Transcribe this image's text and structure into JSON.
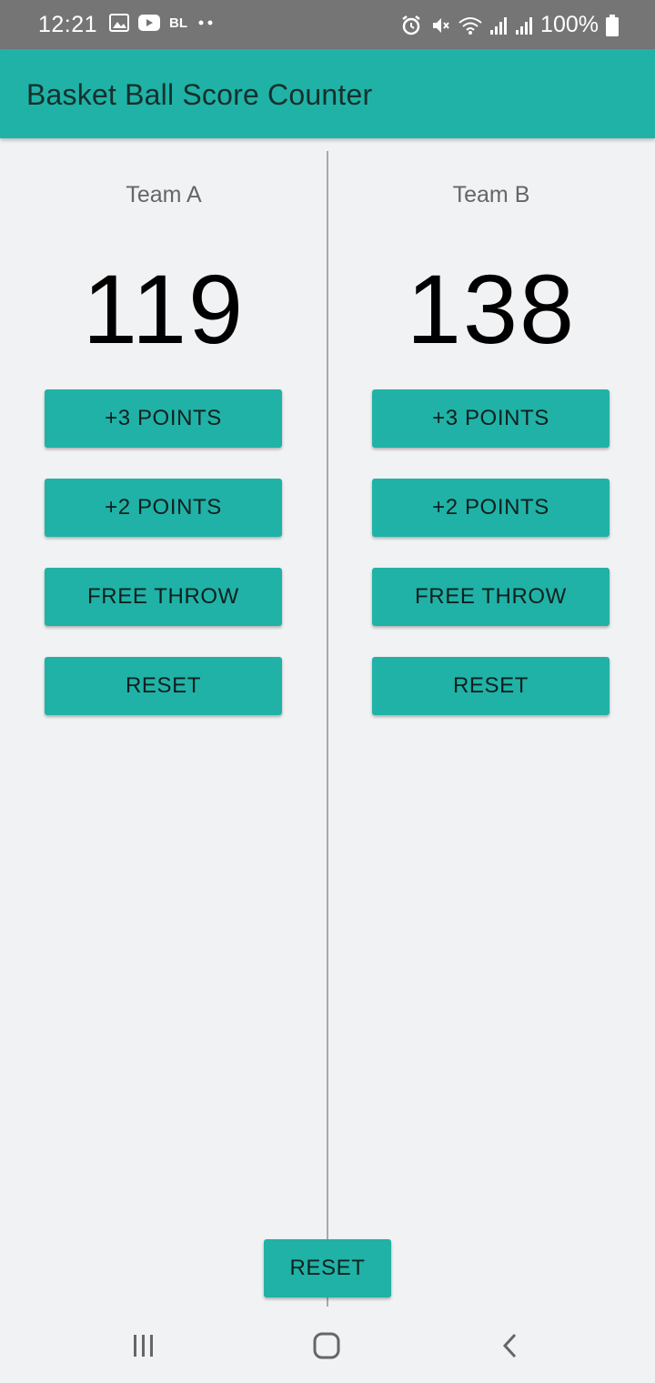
{
  "status_bar": {
    "time": "12:21",
    "battery": "100%",
    "icons": [
      "image-icon",
      "youtube-icon",
      "bl-icon",
      "more-dots-icon",
      "alarm-icon",
      "mute-icon",
      "wifi-icon",
      "signal-icon",
      "signal-icon",
      "battery-icon"
    ],
    "bl_label": "BL"
  },
  "app_bar": {
    "title": "Basket Ball Score Counter"
  },
  "team_a": {
    "name": "Team A",
    "score": "119",
    "buttons": {
      "three": "+3 POINTS",
      "two": "+2 POINTS",
      "free_throw": "FREE THROW",
      "reset": "RESET"
    }
  },
  "team_b": {
    "name": "Team B",
    "score": "138",
    "buttons": {
      "three": "+3 POINTS",
      "two": "+2 POINTS",
      "free_throw": "FREE THROW",
      "reset": "RESET"
    }
  },
  "global_reset_label": "RESET",
  "colors": {
    "accent": "#20b2a6",
    "status_bar": "#757575",
    "background": "#f1f2f4"
  },
  "nav_bar": {
    "icons": [
      "recent-apps-icon",
      "home-icon",
      "back-icon"
    ]
  }
}
